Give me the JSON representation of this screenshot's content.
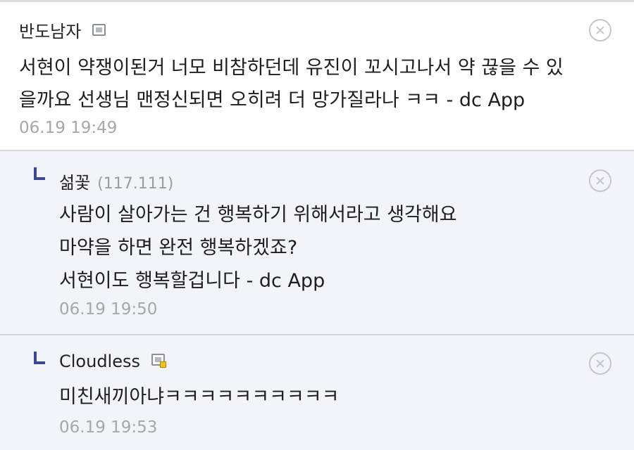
{
  "comments": [
    {
      "author": "반도남자",
      "lines": [
        "서현이 약쟁이된거 너모 비참하던데 유진이 꼬시고나서 약 끊을 수 있",
        "을까요 선생님 맨정신되면 오히려 더 망가질라나 ㅋㅋ - dc App"
      ],
      "time": "06.19 19:49"
    },
    {
      "author": "섦꽃",
      "ip": "(117.111)",
      "lines": [
        "사람이 살아가는 건 행복하기 위해서라고 생각해요",
        "마약을 하면 완전 행복하겠죠?",
        "서현이도 행복할겁니다 - dc App"
      ],
      "time": "06.19 19:50"
    },
    {
      "author": "Cloudless",
      "lines": [
        "미친새끼아냐ㅋㅋㅋㅋㅋㅋㅋㅋㅋㅋ"
      ],
      "time": "06.19 19:53"
    }
  ],
  "colors": {
    "reply_arrow": "#3b4890",
    "reply_bg": "#f3f4f9",
    "timestamp": "#a6a6ad"
  },
  "icons": {
    "delete": "close-circle-icon",
    "reply": "reply-arrow-icon",
    "member_badge": "member-badge-icon"
  }
}
